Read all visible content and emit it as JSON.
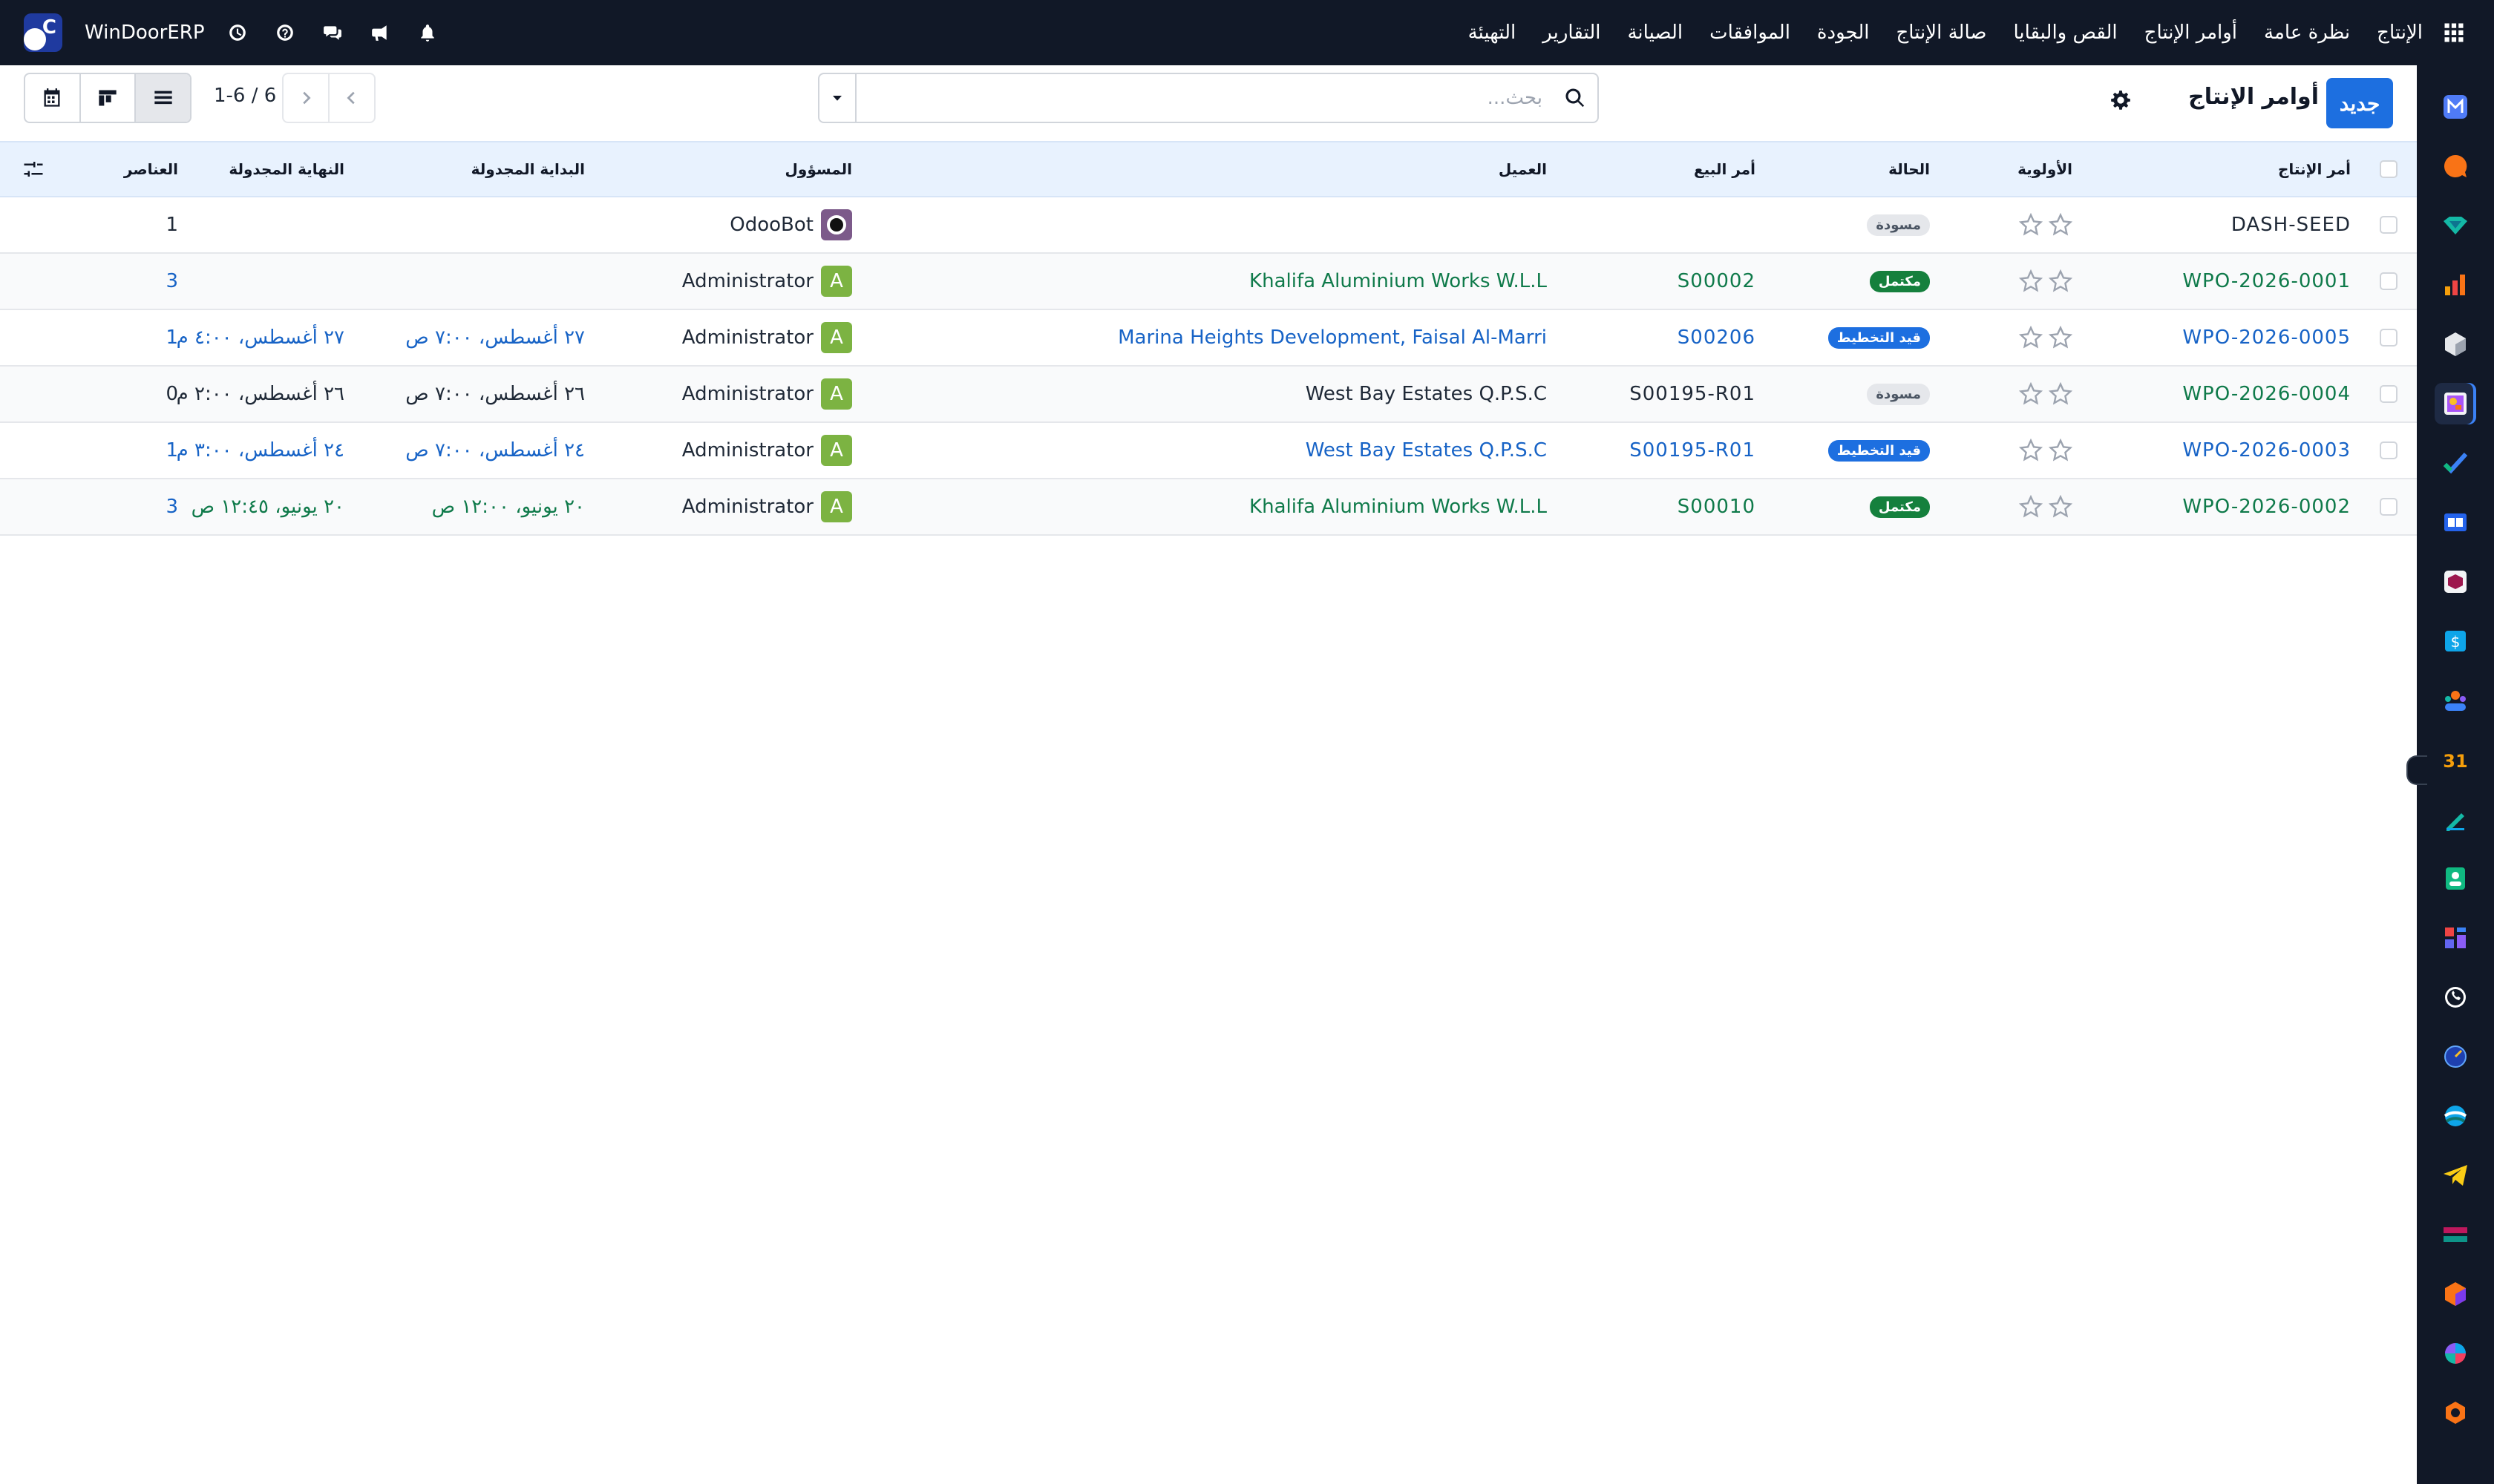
{
  "navbar": {
    "brand": "WinDoorERP",
    "menu": [
      "الإنتاج",
      "نظرة عامة",
      "أوامر الإنتاج",
      "القص والبقايا",
      "صالة الإنتاج",
      "الجودة",
      "الموافقات",
      "الصيانة",
      "التقارير",
      "التهيئة"
    ],
    "icons": [
      "bell-icon",
      "megaphone-icon",
      "chat-icon",
      "help-icon",
      "clock-icon"
    ]
  },
  "control": {
    "new_label": "جديد",
    "title": "أوامر الإنتاج",
    "search_placeholder": "بحث...",
    "pager": "1-6 / 6"
  },
  "table": {
    "headers": {
      "order": "أمر الإنتاج",
      "priority": "الأولوية",
      "status": "الحالة",
      "sale_order": "أمر البيع",
      "customer": "العميل",
      "responsible": "المسؤول",
      "start": "البداية المجدولة",
      "end": "النهاية المجدولة",
      "items": "العناصر"
    },
    "rows": [
      {
        "order": "DASH-SEED",
        "status": "مسودة",
        "sale_order": "",
        "customer": "",
        "responsible": "OdooBot",
        "start": "",
        "end": "",
        "items": "1"
      },
      {
        "order": "WPO-2026-0001",
        "status": "مكتمل",
        "sale_order": "S00002",
        "customer": "Khalifa Aluminium Works W.L.L",
        "responsible": "Administrator",
        "start": "",
        "end": "",
        "items": "3"
      },
      {
        "order": "WPO-2026-0005",
        "status": "قيد التخطيط",
        "sale_order": "S00206",
        "customer": "Marina Heights Development, Faisal Al-Marri",
        "responsible": "Administrator",
        "start": "٢٧ أغسطس، ٧:٠٠ ص",
        "end": "٢٧ أغسطس، ٤:٠٠ م",
        "items": "1"
      },
      {
        "order": "WPO-2026-0004",
        "status": "مسودة",
        "sale_order": "S00195-R01",
        "customer": "West Bay Estates Q.P.S.C",
        "responsible": "Administrator",
        "start": "٢٦ أغسطس، ٧:٠٠ ص",
        "end": "٢٦ أغسطس، ٢:٠٠ م",
        "items": "0"
      },
      {
        "order": "WPO-2026-0003",
        "status": "قيد التخطيط",
        "sale_order": "S00195-R01",
        "customer": "West Bay Estates Q.P.S.C",
        "responsible": "Administrator",
        "start": "٢٤ أغسطس، ٧:٠٠ ص",
        "end": "٢٤ أغسطس، ٣:٠٠ م",
        "items": "1"
      },
      {
        "order": "WPO-2026-0002",
        "status": "مكتمل",
        "sale_order": "S00010",
        "customer": "Khalifa Aluminium Works W.L.L",
        "responsible": "Administrator",
        "start": "٢٠ يونيو، ١٢:٠٠ ص",
        "end": "٢٠ يونيو، ١٢:٤٥ ص",
        "items": "3"
      }
    ]
  },
  "avatar_letter": "A",
  "colors": {
    "navbar": "#111827",
    "primary": "#1d6fe0",
    "link": "#1763c6",
    "done_green": "#15803d",
    "header_bg": "#e8f2fe"
  },
  "sidebar_apps": [
    "mail-app-icon",
    "discuss-app-icon",
    "sign-app-icon",
    "dashboards-app-icon",
    "inventory-app-icon",
    "production-app-icon",
    "todo-app-icon",
    "knowledge-app-icon",
    "product-app-icon",
    "invoicing-app-icon",
    "employees-app-icon",
    "calendar-app-icon",
    "notes-app-icon",
    "contacts-app-icon",
    "spreadsheet-app-icon",
    "whatsapp-app-icon",
    "clock-app-icon",
    "website-app-icon",
    "telegram-app-icon",
    "payroll-app-icon",
    "manufacturing-app-icon",
    "apps-app-icon",
    "settings-app-icon"
  ]
}
